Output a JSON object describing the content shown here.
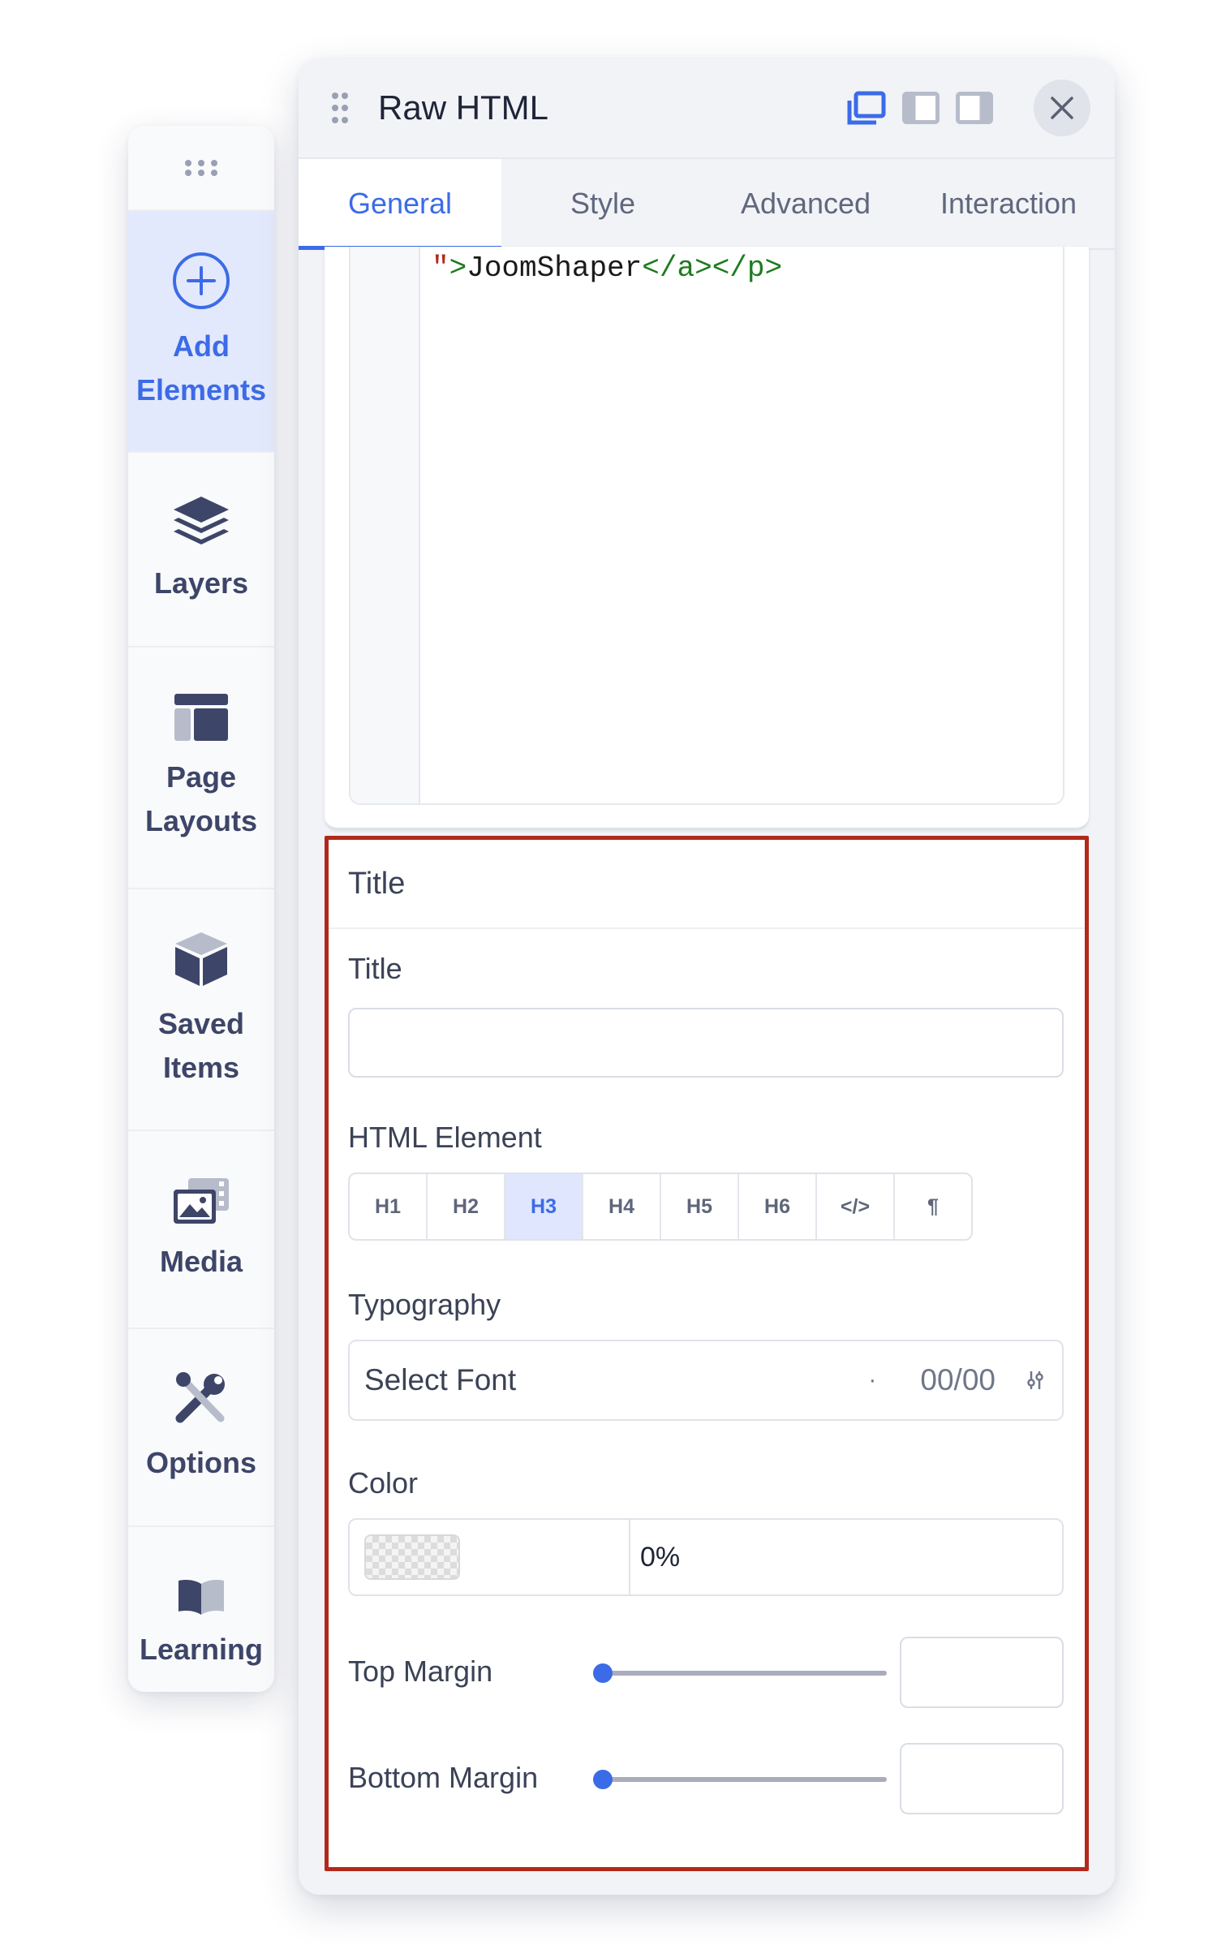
{
  "sidebar": {
    "items": [
      {
        "label": "Add\nElements",
        "icon": "plus-circle-icon",
        "active": true
      },
      {
        "label": "Layers",
        "icon": "layers-icon"
      },
      {
        "label": "Page\nLayouts",
        "icon": "layout-icon"
      },
      {
        "label": "Saved\nItems",
        "icon": "cube-icon"
      },
      {
        "label": "Media",
        "icon": "image-icon"
      },
      {
        "label": "Options",
        "icon": "tools-icon"
      },
      {
        "label": "Learning",
        "icon": "book-icon"
      }
    ]
  },
  "panel": {
    "title": "Raw HTML",
    "tabs": [
      {
        "label": "General",
        "active": true
      },
      {
        "label": "Style"
      },
      {
        "label": "Advanced"
      },
      {
        "label": "Interaction"
      }
    ],
    "code": {
      "quote": "\"",
      "gt": ">",
      "text": "JoomShaper",
      "close_a": "</a>",
      "close_p": "</p>"
    }
  },
  "title_section": {
    "heading": "Title",
    "title_label": "Title",
    "title_value": "",
    "html_element_label": "HTML Element",
    "html_elements": [
      "H1",
      "H2",
      "H3",
      "H4",
      "H5",
      "H6",
      "</>",
      "¶"
    ],
    "html_element_selected": "H3",
    "typography_label": "Typography",
    "typography_placeholder": "Select Font",
    "typography_dot": "·",
    "typography_size": "00/00",
    "color_label": "Color",
    "color_alpha": "0%",
    "top_margin_label": "Top Margin",
    "top_margin_value": 0,
    "bottom_margin_label": "Bottom Margin",
    "bottom_margin_value": 0
  },
  "colors": {
    "accent": "#3c6be8",
    "highlight_border": "#b2291b"
  }
}
